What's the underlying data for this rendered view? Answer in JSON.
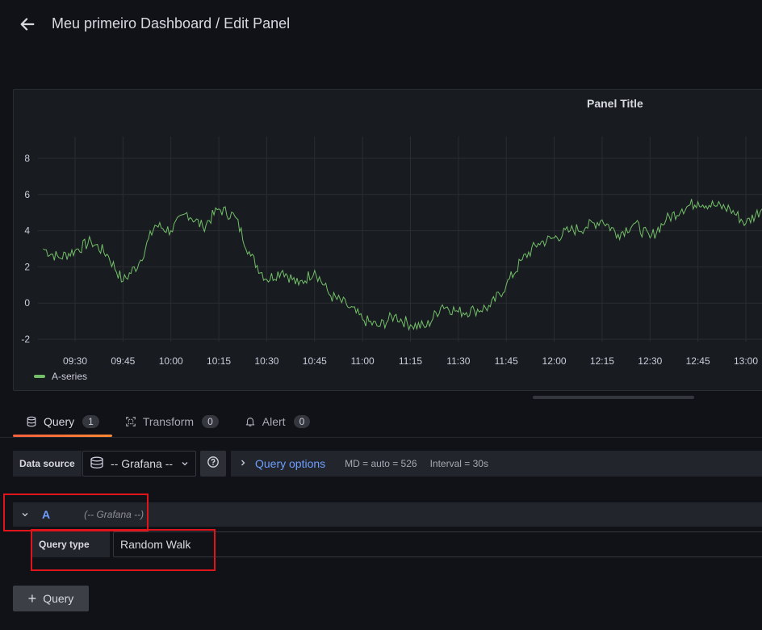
{
  "header": {
    "title": "Meu primeiro Dashboard / Edit Panel"
  },
  "panel": {
    "title": "Panel Title"
  },
  "chart_data": {
    "type": "line",
    "title": "Panel Title",
    "x": [
      "09:20",
      "09:25",
      "09:30",
      "09:35",
      "09:40",
      "09:45",
      "09:50",
      "09:55",
      "10:00",
      "10:05",
      "10:10",
      "10:15",
      "10:20",
      "10:25",
      "10:30",
      "10:35",
      "10:40",
      "10:45",
      "10:50",
      "10:55",
      "11:00",
      "11:05",
      "11:10",
      "11:15",
      "11:20",
      "11:25",
      "11:30",
      "11:35",
      "11:40",
      "11:45",
      "11:50",
      "11:55",
      "12:00",
      "12:05",
      "12:10",
      "12:15",
      "12:20",
      "12:25",
      "12:30",
      "12:35",
      "12:40",
      "12:45",
      "12:50",
      "12:55",
      "13:00",
      "13:05"
    ],
    "series": [
      {
        "name": "A-series",
        "color": "#73bf69",
        "values": [
          3.0,
          2.5,
          2.9,
          3.4,
          2.7,
          1.2,
          2.2,
          4.3,
          4.0,
          5.0,
          4.2,
          5.2,
          4.8,
          2.6,
          1.3,
          1.8,
          1.0,
          1.8,
          0.4,
          -0.1,
          -0.9,
          -1.3,
          -0.7,
          -1.2,
          -1.3,
          -0.1,
          -0.5,
          -0.4,
          -0.2,
          1.0,
          2.4,
          3.3,
          3.6,
          4.0,
          4.2,
          4.6,
          3.8,
          4.4,
          3.6,
          4.6,
          5.2,
          5.6,
          5.4,
          5.2,
          4.4,
          5.2
        ]
      }
    ],
    "xticks": [
      "09:30",
      "09:45",
      "10:00",
      "10:15",
      "10:30",
      "10:45",
      "11:00",
      "11:15",
      "11:30",
      "11:45",
      "12:00",
      "12:15",
      "12:30",
      "12:45",
      "13:00"
    ],
    "yticks": [
      -2,
      0,
      2,
      4,
      6,
      8
    ],
    "ylim": [
      -2.5,
      9
    ],
    "grid": true,
    "legend": "bottom-left"
  },
  "tabs": [
    {
      "label": "Query",
      "count": "1"
    },
    {
      "label": "Transform",
      "count": "0"
    },
    {
      "label": "Alert",
      "count": "0"
    }
  ],
  "query_row": {
    "datasource_label": "Data source",
    "datasource_value": "-- Grafana --",
    "query_options_label": "Query options",
    "md": "MD = auto = 526",
    "interval": "Interval = 30s"
  },
  "query": {
    "ref_id": "A",
    "datasource_name": "(-- Grafana --)",
    "type_label": "Query type",
    "type_value": "Random Walk"
  },
  "add_query_label": "Query"
}
